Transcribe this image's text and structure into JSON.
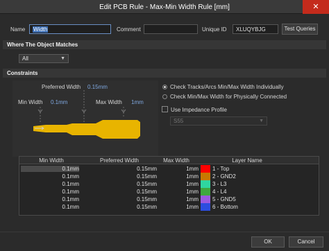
{
  "window": {
    "title": "Edit PCB Rule - Max-Min Width Rule [mm]",
    "close_glyph": "✕"
  },
  "header": {
    "name_label": "Name",
    "name_value": "Width",
    "comment_label": "Comment",
    "comment_value": "",
    "unique_id_label": "Unique ID",
    "unique_id_value": "XLUQYBJG",
    "test_queries_label": "Test Queries"
  },
  "where_section": {
    "title": "Where The Object Matches",
    "scope_value": "All"
  },
  "constraints": {
    "title": "Constraints",
    "preferred_width_label": "Preferred Width",
    "preferred_width_value": "0.15mm",
    "min_width_label": "Min Width",
    "min_width_value": "0.1mm",
    "max_width_label": "Max Width",
    "max_width_value": "1mm",
    "radio_individual_label": "Check Tracks/Arcs Min/Max Width Individually",
    "radio_physical_label": "Check Min/Max Width for Physically Connected",
    "use_impedance_label": "Use Impedance Profile",
    "impedance_profile_value": "S55"
  },
  "table": {
    "headers": [
      "Min Width",
      "Preferred Width",
      "Max Width",
      "Layer Name"
    ],
    "rows": [
      {
        "min": "0.1mm",
        "preferred": "0.15mm",
        "max": "1mm",
        "layer": "1 - Top",
        "color": "#ff0000"
      },
      {
        "min": "0.1mm",
        "preferred": "0.15mm",
        "max": "1mm",
        "layer": "2 - GND2",
        "color": "#c87800"
      },
      {
        "min": "0.1mm",
        "preferred": "0.15mm",
        "max": "1mm",
        "layer": "3 - L3",
        "color": "#2fd6a0"
      },
      {
        "min": "0.1mm",
        "preferred": "0.15mm",
        "max": "1mm",
        "layer": "4 - L4",
        "color": "#3fa83f"
      },
      {
        "min": "0.1mm",
        "preferred": "0.15mm",
        "max": "1mm",
        "layer": "5 - GND5",
        "color": "#9a5ae0"
      },
      {
        "min": "0.1mm",
        "preferred": "0.15mm",
        "max": "1mm",
        "layer": "6 - Bottom",
        "color": "#2d4de0"
      }
    ]
  },
  "footer": {
    "ok_label": "OK",
    "cancel_label": "Cancel"
  },
  "colors": {
    "track": "#e8b400",
    "accent_value": "#7fa8e0",
    "close_button": "#c42b1c"
  }
}
